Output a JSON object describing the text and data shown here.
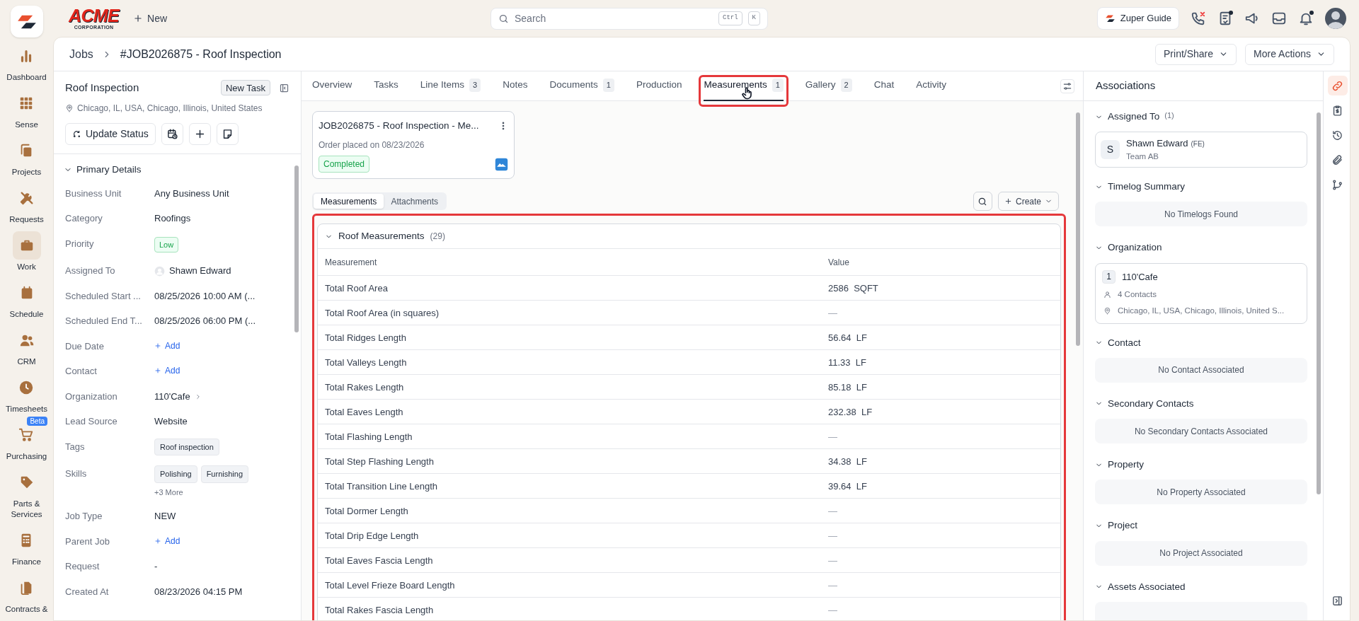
{
  "top_bar": {
    "logo_text": "ACME",
    "logo_subtext": "CORPORATION",
    "new_label": "New",
    "search_placeholder": "Search",
    "shortcut_keys": [
      "Ctrl",
      "K"
    ],
    "guide_label": "Zuper Guide",
    "icons": [
      {
        "kind": "phone"
      },
      {
        "kind": "checklist",
        "badge": true
      },
      {
        "kind": "megaphone"
      },
      {
        "kind": "inbox"
      },
      {
        "kind": "bell",
        "badge": true
      }
    ]
  },
  "nav": [
    {
      "label": "Dashboard",
      "kind": "chart",
      "selected": false
    },
    {
      "label": "Sense",
      "kind": "grid",
      "selected": false
    },
    {
      "label": "Projects",
      "kind": "copy",
      "selected": false
    },
    {
      "label": "Requests",
      "kind": "tools",
      "selected": false
    },
    {
      "label": "Work",
      "kind": "briefcase",
      "selected": true
    },
    {
      "label": "Schedule",
      "kind": "calendar",
      "selected": false
    },
    {
      "label": "CRM",
      "kind": "users",
      "selected": false
    },
    {
      "label": "Timesheets",
      "kind": "clock",
      "selected": false
    },
    {
      "label": "Purchasing",
      "kind": "cart",
      "selected": false,
      "badge": "Beta"
    },
    {
      "label": "Parts & Services",
      "kind": "tag",
      "selected": false
    },
    {
      "label": "Finance",
      "kind": "calculator",
      "selected": false
    },
    {
      "label": "Contracts &",
      "kind": "files",
      "selected": false
    }
  ],
  "breadcrumb": [
    "Jobs",
    "#JOB2026875 - Roof Inspection"
  ],
  "header_buttons": [
    "Print/Share",
    "More Actions"
  ],
  "job": {
    "title": "Roof Inspection",
    "new_task": "New Task",
    "address": "Chicago, IL, USA, Chicago, Illinois, United States",
    "update_status": "Update Status",
    "section": {
      "title": "Primary Details",
      "expanded": true,
      "fields": [
        {
          "label": "Business Unit",
          "kind": "text",
          "value": "Any Business Unit"
        },
        {
          "label": "Category",
          "kind": "text",
          "value": "Roofings"
        },
        {
          "label": "Priority",
          "kind": "badge",
          "value": "Low",
          "color": "#16a34a"
        },
        {
          "label": "Assigned To",
          "kind": "person",
          "value": "Shawn Edward"
        },
        {
          "label": "Scheduled Start ...",
          "kind": "text",
          "value": "08/25/2026 10:00 AM (..."
        },
        {
          "label": "Scheduled End T...",
          "kind": "text",
          "value": "08/25/2026 06:00 PM (..."
        },
        {
          "label": "Due Date",
          "kind": "add",
          "value": "Add"
        },
        {
          "label": "Contact",
          "kind": "add",
          "value": "Add"
        },
        {
          "label": "Organization",
          "kind": "link",
          "value": "110'Cafe"
        },
        {
          "label": "Lead Source",
          "kind": "text",
          "value": "Website"
        },
        {
          "label": "Tags",
          "kind": "tags",
          "tags": [
            "Roof inspection"
          ]
        },
        {
          "label": "Skills",
          "kind": "tags",
          "tags": [
            "Polishing",
            "Furnishing"
          ],
          "more": "+3 More"
        },
        {
          "label": "Job Type",
          "kind": "text",
          "value": "NEW"
        },
        {
          "label": "Parent Job",
          "kind": "add",
          "value": "Add"
        },
        {
          "label": "Request",
          "kind": "text",
          "value": "-"
        },
        {
          "label": "Created At",
          "kind": "text",
          "value": "08/23/2026 04:15 PM"
        }
      ]
    }
  },
  "tabs": [
    {
      "label": "Overview",
      "selected": false
    },
    {
      "label": "Tasks",
      "selected": false
    },
    {
      "label": "Line Items",
      "count": "3",
      "selected": false
    },
    {
      "label": "Notes",
      "selected": false
    },
    {
      "label": "Documents",
      "count": "1",
      "selected": false
    },
    {
      "label": "Production",
      "selected": false
    },
    {
      "label": "Measurements",
      "count": "1",
      "selected": true
    },
    {
      "label": "Gallery",
      "count": "2",
      "selected": false
    },
    {
      "label": "Chat",
      "selected": false
    },
    {
      "label": "Activity",
      "selected": false
    }
  ],
  "order_card": {
    "title": "JOB2026875 - Roof Inspection - Me...",
    "subtitle": "Order placed on 08/23/2026",
    "status": "Completed"
  },
  "sub_tabs": [
    {
      "label": "Measurements",
      "selected": true
    },
    {
      "label": "Attachments",
      "selected": false
    }
  ],
  "create_label": "Create",
  "group": {
    "title": "Roof Measurements",
    "count": "(29)",
    "expanded": true,
    "columns": [
      "Measurement",
      "Value"
    ],
    "rows": [
      {
        "name": "Total Roof Area",
        "value": "2586",
        "unit": "SQFT"
      },
      {
        "name": "Total Roof Area (in squares)",
        "value": "—"
      },
      {
        "name": "Total Ridges Length",
        "value": "56.64",
        "unit": "LF"
      },
      {
        "name": "Total Valleys Length",
        "value": "11.33",
        "unit": "LF"
      },
      {
        "name": "Total Rakes Length",
        "value": "85.18",
        "unit": "LF"
      },
      {
        "name": "Total Eaves Length",
        "value": "232.38",
        "unit": "LF"
      },
      {
        "name": "Total Flashing Length",
        "value": "—"
      },
      {
        "name": "Total Step Flashing Length",
        "value": "34.38",
        "unit": "LF"
      },
      {
        "name": "Total Transition Line Length",
        "value": "39.64",
        "unit": "LF"
      },
      {
        "name": "Total Dormer Length",
        "value": "—"
      },
      {
        "name": "Total Drip Edge Length",
        "value": "—"
      },
      {
        "name": "Total Eaves Fascia Length",
        "value": "—"
      },
      {
        "name": "Total Level Frieze Board Length",
        "value": "—"
      },
      {
        "name": "Total Rakes Fascia Length",
        "value": "—"
      }
    ]
  },
  "associations": {
    "title": "Associations",
    "sections": [
      {
        "title": "Assigned To",
        "count": "(1)",
        "kind": "person",
        "expanded": true,
        "initial": "S",
        "name": "Shawn Edward",
        "role": "(FE)",
        "team": "Team AB"
      },
      {
        "title": "Timelog Summary",
        "kind": "empty",
        "expanded": true,
        "message": "No Timelogs Found"
      },
      {
        "title": "Organization",
        "kind": "org",
        "expanded": true,
        "index": "1",
        "name": "110'Cafe",
        "contacts": "4 Contacts",
        "address": "Chicago, IL, USA, Chicago, Illinois, United S..."
      },
      {
        "title": "Contact",
        "kind": "empty",
        "expanded": true,
        "message": "No Contact Associated"
      },
      {
        "title": "Secondary Contacts",
        "kind": "empty",
        "expanded": true,
        "message": "No Secondary Contacts Associated"
      },
      {
        "title": "Property",
        "kind": "empty",
        "expanded": true,
        "message": "No Property Associated"
      },
      {
        "title": "Project",
        "kind": "empty",
        "expanded": true,
        "message": "No Project Associated"
      },
      {
        "title": "Assets Associated",
        "kind": "empty",
        "expanded": true
      }
    ]
  },
  "side_icons": [
    {
      "kind": "link",
      "selected": true
    },
    {
      "kind": "invoice",
      "selected": false
    },
    {
      "kind": "history",
      "selected": false
    },
    {
      "kind": "paperclip",
      "selected": false
    },
    {
      "kind": "branch",
      "selected": false
    }
  ]
}
